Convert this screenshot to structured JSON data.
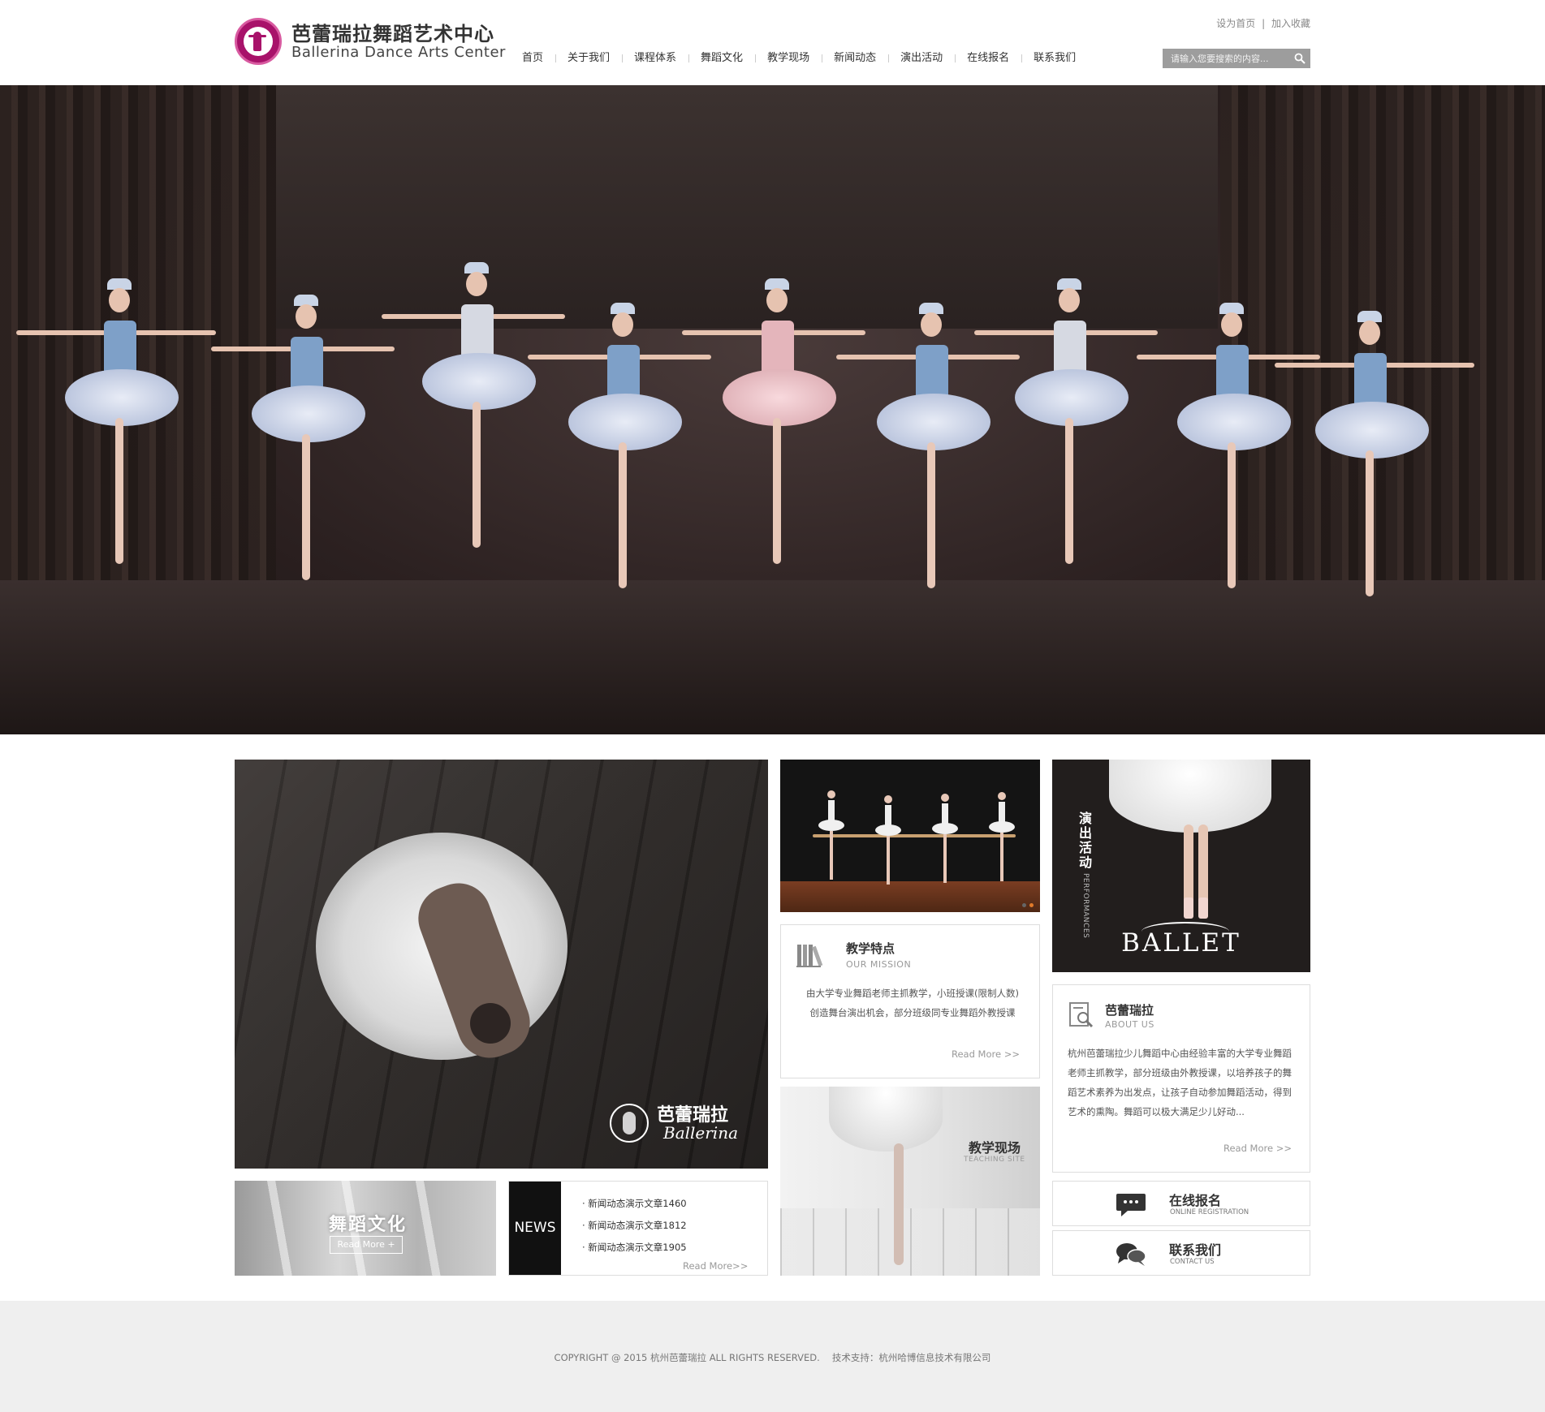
{
  "header": {
    "logo_cn": "芭蕾瑞拉舞蹈艺术中心",
    "logo_en": "Ballerina Dance Arts Center",
    "top_links": [
      "设为首页",
      "加入收藏"
    ],
    "top_links_separator": "|",
    "nav": [
      "首页",
      "关于我们",
      "课程体系",
      "舞蹈文化",
      "教学现场",
      "新闻动态",
      "演出活动",
      "在线报名",
      "联系我们"
    ],
    "search": {
      "placeholder": "请输入您要搜索的内容..."
    }
  },
  "colors": {
    "brand": "#a8126a",
    "search_bg": "#9d9d9d",
    "footer_bg": "#efefef",
    "dot_active": "#e07a2a"
  },
  "featured": {
    "brand_cn": "芭蕾瑞拉",
    "brand_en": "Ballerina"
  },
  "performances": {
    "title_cn": "演出活动",
    "title_en": "PERFORMANCES",
    "word": "BALLET"
  },
  "mission": {
    "icon": "books-icon",
    "title": "教学特点",
    "subtitle": "OUR MISSION",
    "body": [
      "由大学专业舞蹈老师主抓教学，小班授课(限制人数)",
      "创造舞台演出机会，部分班级同专业舞蹈外教授课"
    ],
    "more": "Read More >>"
  },
  "about": {
    "icon": "document-search-icon",
    "title": "芭蕾瑞拉",
    "subtitle": "ABOUT US",
    "body": "杭州芭蕾瑞拉少儿舞蹈中心由经验丰富的大学专业舞蹈老师主抓教学，部分班级由外教授课，以培养孩子的舞蹈艺术素养为出发点，让孩子自动参加舞蹈活动，得到艺术的熏陶。舞蹈可以极大满足少儿好动...",
    "more": "Read More >>"
  },
  "culture": {
    "title": "舞蹈文化",
    "button": "Read More +"
  },
  "news": {
    "label": "NEWS",
    "items": [
      "· 新闻动态演示文章1460",
      "· 新闻动态演示文章1812",
      "· 新闻动态演示文章1905"
    ],
    "more": "Read More>>"
  },
  "teaching": {
    "title": "教学现场",
    "subtitle": "TEACHING SITE"
  },
  "registration": {
    "icon": "chat-bubble-icon",
    "title": "在线报名",
    "subtitle": "ONLINE REGISTRATION"
  },
  "contact": {
    "icon": "chat-bubbles-icon",
    "title": "联系我们",
    "subtitle": "CONTACT US"
  },
  "footer": {
    "copyright": "COPYRIGHT @ 2015 杭州芭蕾瑞拉 ALL RIGHTS RESERVED.　  技术支持：杭州哈博信息技术有限公司"
  }
}
